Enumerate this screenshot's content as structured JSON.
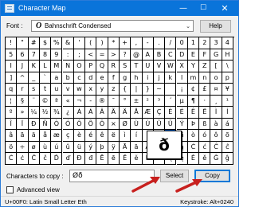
{
  "window": {
    "title": "Character Map",
    "controls": {
      "minimize_icon": "minimize-icon",
      "maximize_icon": "maximize-icon",
      "close_icon": "close-icon"
    }
  },
  "toolbar": {
    "font_label": "Font :",
    "font_glyph": "O",
    "font_value": "Bahnschrift Condensed",
    "help_label": "Help"
  },
  "grid": {
    "rows": [
      [
        "!",
        "\"",
        "#",
        "$",
        "%",
        "&",
        "'",
        "(",
        ")",
        "*",
        "+",
        ",",
        "-",
        ".",
        "/",
        "0",
        "1",
        "2",
        "3",
        "4"
      ],
      [
        "5",
        "6",
        "7",
        "8",
        "9",
        ":",
        ";",
        "<",
        "=",
        ">",
        "?",
        "@",
        "A",
        "B",
        "C",
        "D",
        "E",
        "F",
        "G",
        "H"
      ],
      [
        "I",
        "J",
        "K",
        "L",
        "M",
        "N",
        "O",
        "P",
        "Q",
        "R",
        "S",
        "T",
        "U",
        "V",
        "W",
        "X",
        "Y",
        "Z",
        "[",
        "\\"
      ],
      [
        "]",
        "^",
        "_",
        "`",
        "a",
        "b",
        "c",
        "d",
        "e",
        "f",
        "g",
        "h",
        "i",
        "j",
        "k",
        "l",
        "m",
        "n",
        "o",
        "p"
      ],
      [
        "q",
        "r",
        "s",
        "t",
        "u",
        "v",
        "w",
        "x",
        "y",
        "z",
        "{",
        "|",
        "}",
        "~",
        "",
        "¡",
        "¢",
        "£",
        "¤",
        "¥"
      ],
      [
        "¦",
        "§",
        "¨",
        "©",
        "ª",
        "«",
        "¬",
        "-",
        "®",
        "¯",
        "°",
        "±",
        "²",
        "³",
        "´",
        "µ",
        "¶",
        "·",
        "¸",
        "¹"
      ],
      [
        "º",
        "»",
        "¼",
        "½",
        "¾",
        "¿",
        "À",
        "Á",
        "Â",
        "Ã",
        "Ä",
        "Å",
        "Æ",
        "Ç",
        "È",
        "É",
        "Ê",
        "Ë",
        "Ì",
        "Í"
      ],
      [
        "Î",
        "Ï",
        "Ð",
        "Ñ",
        "Ò",
        "Ó",
        "Ô",
        "Õ",
        "Ö",
        "×",
        "Ø",
        "Ù",
        "Ú",
        "Û",
        "Ü",
        "Ý",
        "Þ",
        "ß",
        "à",
        "á"
      ],
      [
        "â",
        "ã",
        "ä",
        "å",
        "æ",
        "ç",
        "è",
        "é",
        "ê",
        "ë",
        "ì",
        "í",
        "î",
        "ï",
        "ð",
        "ñ",
        "ò",
        "ó",
        "ô",
        "õ"
      ],
      [
        "ö",
        "÷",
        "ø",
        "ù",
        "ú",
        "û",
        "ü",
        "ý",
        "þ",
        "ÿ",
        "Ā",
        "ā",
        "Ă",
        "ă",
        "Ą",
        "ą",
        "Ć",
        "ć",
        "Ĉ",
        "ĉ"
      ],
      [
        "Ċ",
        "ċ",
        "Č",
        "č",
        "Ď",
        "ď",
        "Đ",
        "đ",
        "Ē",
        "ē",
        "Ĕ",
        "ĕ",
        "Ė",
        "ė",
        "Ę",
        "ę",
        "Ě",
        "ě",
        "Ĝ",
        "ĝ"
      ]
    ],
    "selected": {
      "row": 8,
      "col": 14
    },
    "zoom_char": "ð"
  },
  "copy": {
    "label": "Characters to copy :",
    "value": "Øð",
    "select_label": "Select",
    "copy_label": "Copy"
  },
  "advanced": {
    "label": "Advanced view",
    "checked": false
  },
  "status": {
    "left": "U+00F0: Latin Small Letter Eth",
    "right": "Keystroke: Alt+0240"
  },
  "colors": {
    "titlebar": "#0a74da",
    "selection": "#0a64c8",
    "annotation_arrow": "#c8201e"
  }
}
